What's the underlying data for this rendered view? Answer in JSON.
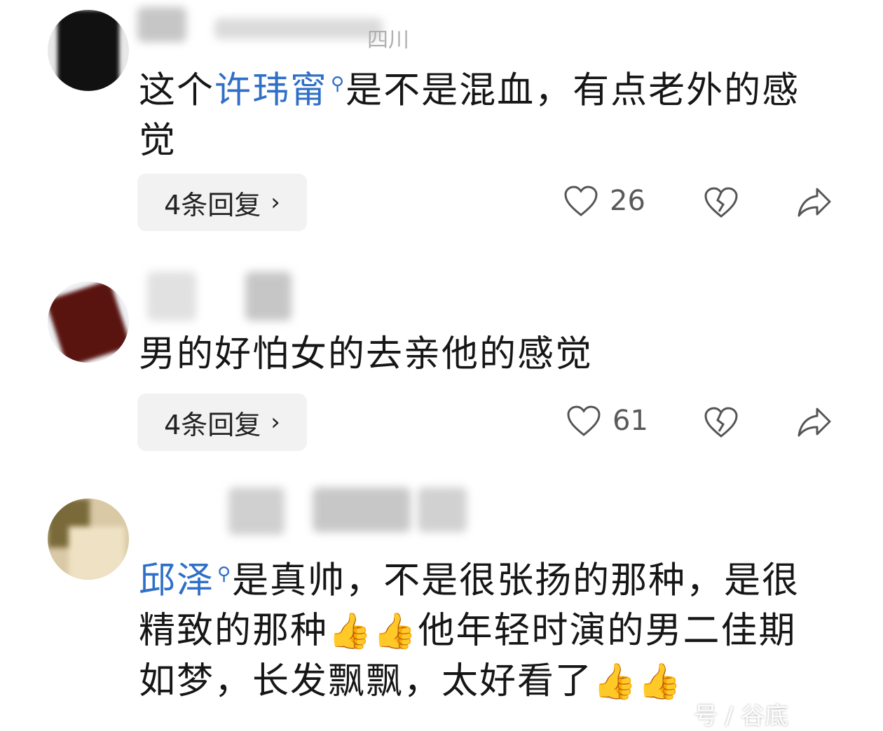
{
  "comments": [
    {
      "username": "",
      "location": "四川",
      "text_prefix": "这个",
      "link": "许玮甯",
      "text_suffix": "是不是混血，有点老外的感觉",
      "reply_label": "4条回复",
      "likes": "26"
    },
    {
      "username": "",
      "text": "男的好怕女的去亲他的感觉",
      "reply_label": "4条回复",
      "likes": "61"
    },
    {
      "username": "",
      "link": "邱泽",
      "text_1": "是真帅，不是很张扬的那种，是很精致的那种",
      "text_2": "他年轻时演的男二佳期如梦，长发飘飘，太好看了",
      "thumbs": "👍"
    }
  ],
  "icons": {
    "search": "search-icon",
    "like": "heart-icon",
    "dislike": "broken-heart-icon",
    "share": "share-icon",
    "chevron": "chevron-right-icon"
  },
  "watermark": "号 / 谷底",
  "colors": {
    "link": "#2f6fc7",
    "reply_bg": "#f2f2f2",
    "icon": "#555555"
  }
}
